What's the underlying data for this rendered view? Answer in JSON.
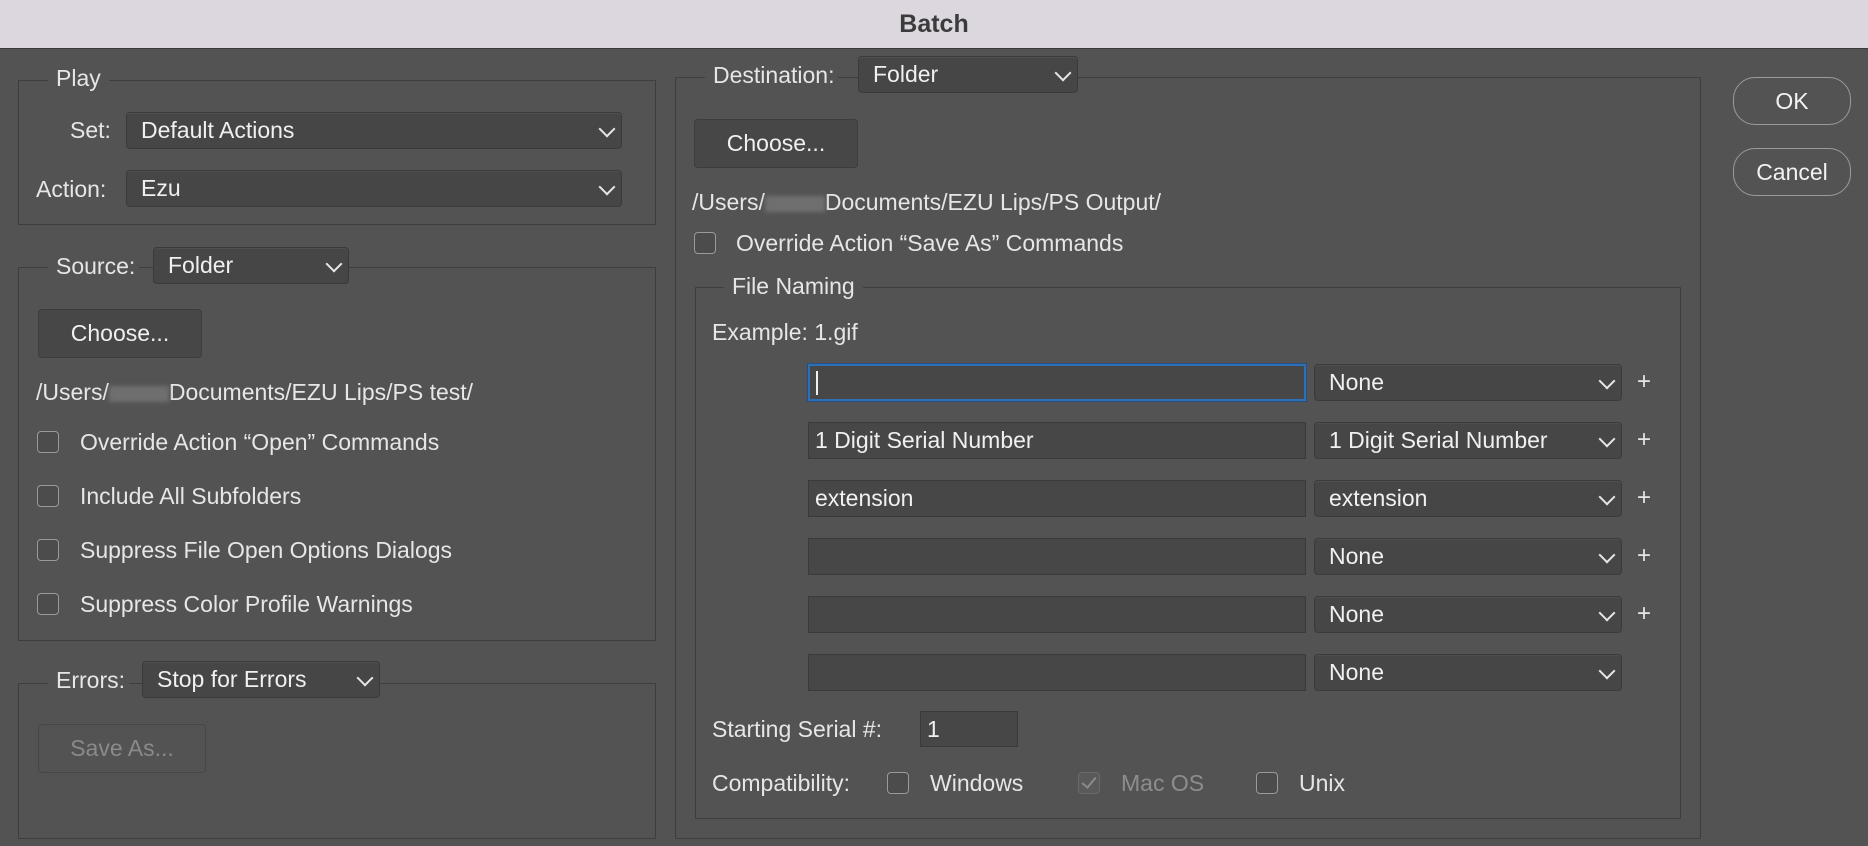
{
  "window": {
    "title": "Batch"
  },
  "buttons": {
    "ok": "OK",
    "cancel": "Cancel"
  },
  "play": {
    "legend": "Play",
    "set_label": "Set:",
    "set_value": "Default Actions",
    "action_label": "Action:",
    "action_value": "Ezu"
  },
  "source": {
    "label": "Source:",
    "value": "Folder",
    "choose": "Choose...",
    "path_prefix": "/Users/",
    "path_suffix": "Documents/EZU Lips/PS test/",
    "options": [
      {
        "label": "Override Action “Open” Commands",
        "checked": false
      },
      {
        "label": "Include All Subfolders",
        "checked": false
      },
      {
        "label": "Suppress File Open Options Dialogs",
        "checked": false
      },
      {
        "label": "Suppress Color Profile Warnings",
        "checked": false
      }
    ]
  },
  "errors": {
    "label": "Errors:",
    "value": "Stop for Errors",
    "save_as": "Save As..."
  },
  "destination": {
    "label": "Destination:",
    "value": "Folder",
    "choose": "Choose...",
    "path_prefix": "/Users/",
    "path_suffix": "Documents/EZU Lips/PS Output/",
    "override_label": "Override Action “Save As” Commands",
    "override_checked": false
  },
  "file_naming": {
    "legend": "File Naming",
    "example": "Example: 1.gif",
    "rows": [
      {
        "text": "",
        "select": "None",
        "plus": "+"
      },
      {
        "text": "1 Digit Serial Number",
        "select": "1 Digit Serial Number",
        "plus": "+"
      },
      {
        "text": "extension",
        "select": "extension",
        "plus": "+"
      },
      {
        "text": "",
        "select": "None",
        "plus": "+"
      },
      {
        "text": "",
        "select": "None",
        "plus": "+"
      },
      {
        "text": "",
        "select": "None",
        "plus": ""
      }
    ],
    "serial_label": "Starting Serial #:",
    "serial_value": "1",
    "compat_label": "Compatibility:",
    "compat": [
      {
        "label": "Windows",
        "checked": false,
        "disabled": false
      },
      {
        "label": "Mac OS",
        "checked": true,
        "disabled": true
      },
      {
        "label": "Unix",
        "checked": false,
        "disabled": false
      }
    ]
  },
  "colors": {
    "dialog_bg": "#535353",
    "titlebar_bg": "#dcd7df",
    "focus_ring": "#2f6fb6"
  }
}
